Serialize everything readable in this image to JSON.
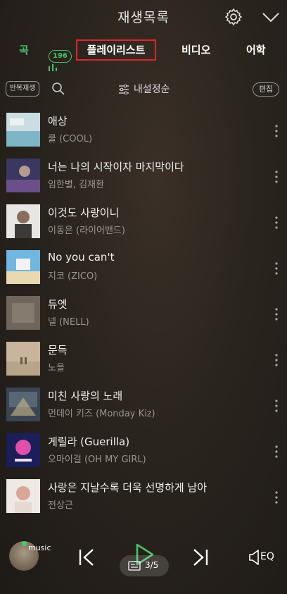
{
  "header": {
    "title": "재생목록"
  },
  "tabs": {
    "songs": "곡",
    "songs_count": "196",
    "playlist": "플레이리스트",
    "video": "비디오",
    "language": "어학"
  },
  "toolbar": {
    "repeat": "반복재생",
    "sort": "내설정순",
    "edit": "편집"
  },
  "songs": [
    {
      "title": "애상",
      "artist": "쿨 (COOL)"
    },
    {
      "title": "너는 나의 시작이자 마지막이다",
      "artist": "임한별, 김재환"
    },
    {
      "title": "이것도 사랑이니",
      "artist": "이동은 (라이어밴드)"
    },
    {
      "title": "No you can't",
      "artist": "지코 (ZICO)"
    },
    {
      "title": "듀엣",
      "artist": "넬 (NELL)"
    },
    {
      "title": "문득",
      "artist": "노을"
    },
    {
      "title": "미친 사랑의 노래",
      "artist": "먼데이 키즈 (Monday Kiz)"
    },
    {
      "title": "게릴라 (Guerilla)",
      "artist": "오마이걸 (OH MY GIRL)"
    },
    {
      "title": "사랑은 지날수록 더욱 선명하게 남아",
      "artist": "전상근"
    }
  ],
  "player": {
    "avatar_label": "music",
    "page": "3/5",
    "eq": "EQ"
  },
  "colors": {
    "accent": "#4ac06a",
    "highlight_border": "#e0262a"
  }
}
